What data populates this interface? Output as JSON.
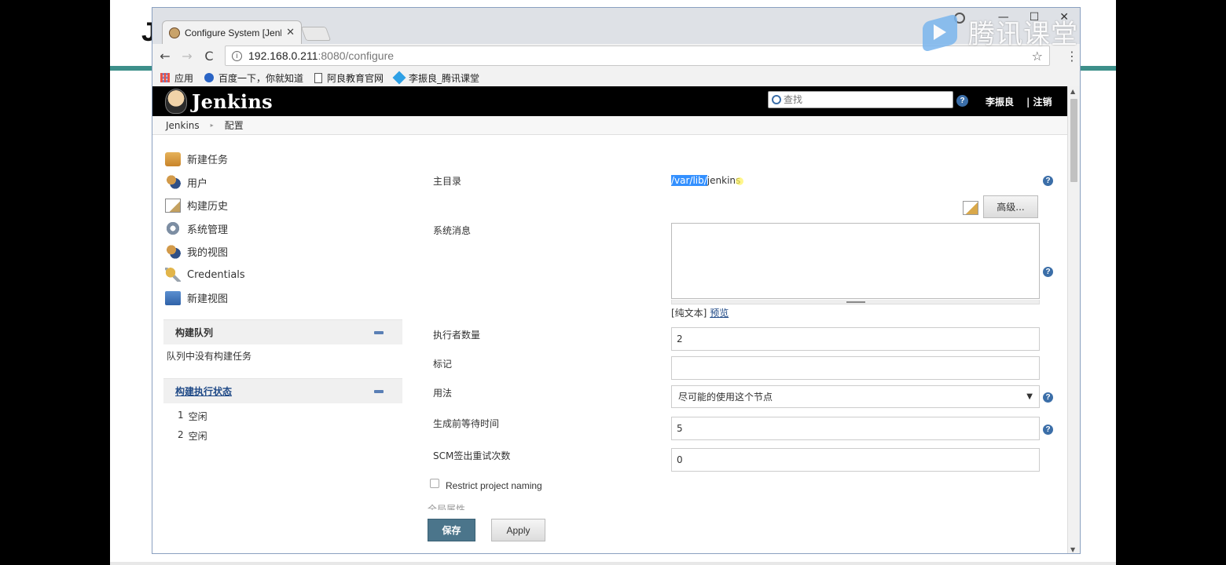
{
  "slide": {
    "letter": "J"
  },
  "browser": {
    "tab_title": "Configure System [Jenkins]",
    "tab_close": "✕",
    "url_host": "192.168.0.211",
    "url_rest": ":8080/configure",
    "info_glyph": "i",
    "star_glyph": "☆",
    "menu_glyph": "⋮",
    "back_glyph": "←",
    "forward_glyph": "→",
    "reload_glyph": "C",
    "window_controls": {
      "minimize": "—",
      "maximize": "☐",
      "close": "✕"
    },
    "bookmarks": [
      {
        "label": "应用",
        "icon": "apps-grid-icon"
      },
      {
        "label": "百度一下，你就知道",
        "icon": "baidu-paw-icon"
      },
      {
        "label": "阿良教育官网",
        "icon": "page-icon"
      },
      {
        "label": "李振良_腾讯课堂",
        "icon": "tencent-gem-icon"
      }
    ]
  },
  "watermark": {
    "text": "腾讯课堂"
  },
  "jenkins": {
    "title": "Jenkins",
    "search_placeholder": "查找",
    "help_glyph": "?",
    "user": "李振良",
    "logout": "| 注销",
    "breadcrumb": [
      "Jenkins",
      "配置"
    ],
    "breadcrumb_sep": "▸",
    "nav": [
      {
        "label": "新建任务",
        "icon": "new-task-icon"
      },
      {
        "label": "用户",
        "icon": "users-icon"
      },
      {
        "label": "构建历史",
        "icon": "build-history-icon"
      },
      {
        "label": "系统管理",
        "icon": "gear-icon"
      },
      {
        "label": "我的视图",
        "icon": "my-views-icon"
      },
      {
        "label": "Credentials",
        "icon": "credentials-key-icon"
      },
      {
        "label": "新建视图",
        "icon": "folder-icon"
      }
    ],
    "build_queue": {
      "title": "构建队列",
      "empty_text": "队列中没有构建任务"
    },
    "executors": {
      "title": "构建执行状态",
      "rows": [
        {
          "num": "1",
          "status": "空闲"
        },
        {
          "num": "2",
          "status": "空闲"
        }
      ]
    },
    "form": {
      "home_dir_label": "主目录",
      "home_dir_selected": "/var/lib/",
      "home_dir_rest": "jenkins",
      "advanced_label": "高级...",
      "system_message_label": "系统消息",
      "system_message_value": "",
      "markup_prefix": "[纯文本]",
      "preview_link": "预览",
      "executors_label": "执行者数量",
      "executors_value": "2",
      "labels_label": "标记",
      "labels_value": "",
      "usage_label": "用法",
      "usage_value": "尽可能的使用这个节点",
      "quiet_period_label": "生成前等待时间",
      "quiet_period_value": "5",
      "scm_retry_label": "SCM签出重试次数",
      "scm_retry_value": "0",
      "restrict_naming_label": "Restrict project naming",
      "global_props_label": "全局属性",
      "save_label": "保存",
      "apply_label": "Apply"
    }
  }
}
